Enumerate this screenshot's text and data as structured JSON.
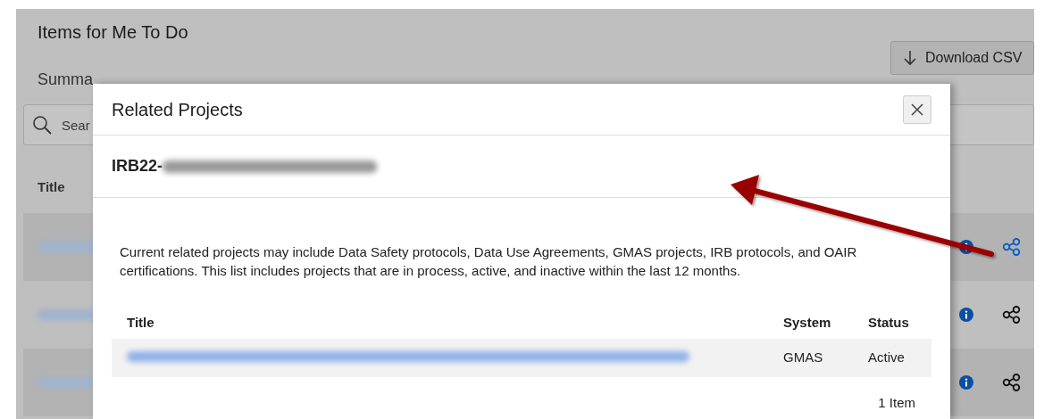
{
  "page": {
    "title": "Items for Me To Do",
    "summary_label": "Summa",
    "download_button": "Download CSV",
    "search": {
      "placeholder": "Sear"
    },
    "table": {
      "columns": [
        "Title"
      ],
      "rows": [
        {
          "shaded": true,
          "share_highlighted": true
        },
        {
          "shaded": false,
          "share_highlighted": false
        },
        {
          "shaded": true,
          "share_highlighted": false
        }
      ]
    }
  },
  "modal": {
    "title": "Related Projects",
    "project_id": "IRB22-",
    "description": "Current related projects may include Data Safety protocols, Data Use Agreements, GMAS projects, IRB protocols, and OAIR certifications. This list includes projects that are in process, active, and inactive within the last 12 months.",
    "table": {
      "columns": [
        "Title",
        "System",
        "Status"
      ],
      "rows": [
        {
          "system": "GMAS",
          "status": "Active"
        }
      ]
    },
    "item_count": "1 Item"
  }
}
